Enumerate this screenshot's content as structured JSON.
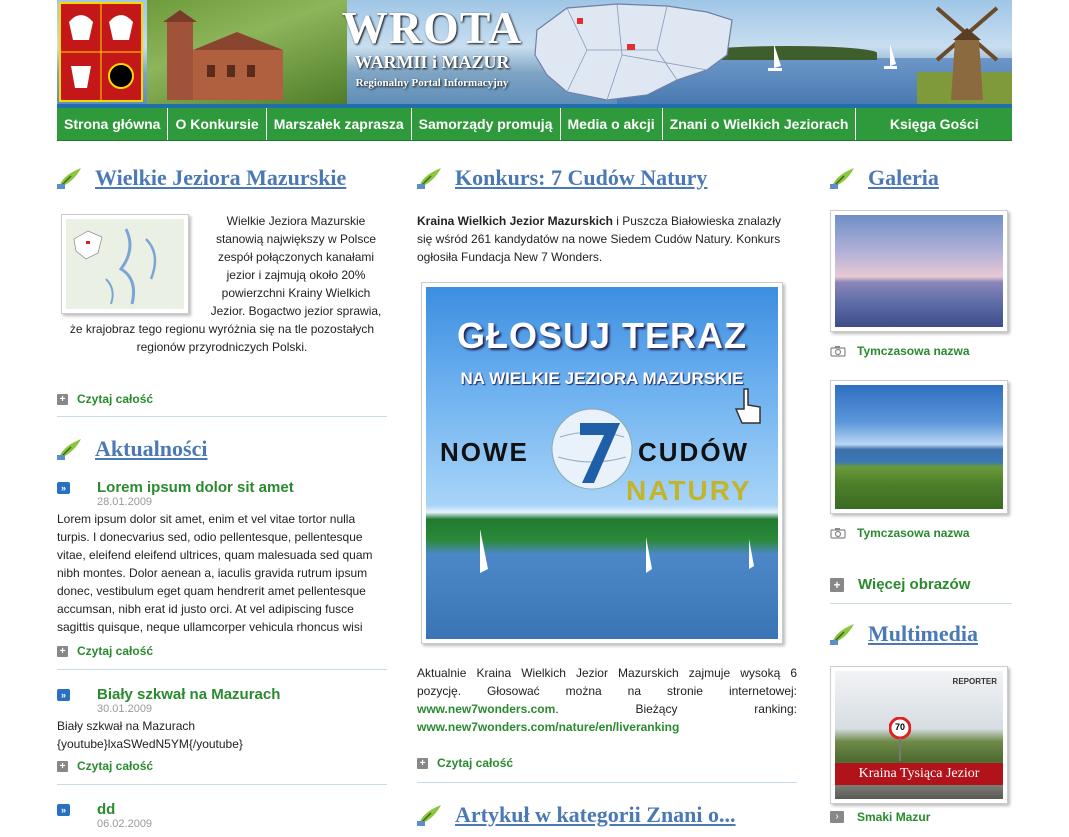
{
  "brand": {
    "title": "WROTA",
    "subtitle": "WARMII i MAZUR",
    "tagline": "Regionalny Portal Informacyjny"
  },
  "nav": [
    "Strona główna",
    "O Konkursie",
    "Marszałek zaprasza",
    "Samorządy promują",
    "Media o akcji",
    "Znani o Wielkich Jeziorach",
    "Księga Gości"
  ],
  "left": {
    "title": "Wielkie Jeziora Mazurskie",
    "text": "Wielkie Jeziora Mazurskie stanowią największy w Polsce zespół połączonych kanałami jezior i zajmują około 20% powierzchni Krainy Wielkich Jezior. Bogactwo jezior sprawia, że krajobraz tego regionu wyróżnia się na tle pozostałych regionów przyrodniczych Polski.",
    "more": "Czytaj całość",
    "news_title": "Aktualności",
    "news": [
      {
        "title": "Lorem ipsum dolor sit amet",
        "date": "28.01.2009",
        "text": "Lorem ipsum dolor sit amet, enim et vel vitae tortor nulla turpis.  I donecvarius sed, odio pellentesque, pellentesque vitae, eleifend eleifend ultrices, quam malesuada sed quam nibh montes. Dolor aenean a, iaculis gravida rutrum ipsum donec, vestibulum eget quam hendrerit amet pellentesque accumsan, nibh erat id justo orci. At vel adipiscing fusce sagittis quisque, neque ullamcorper vehicula rhoncus wisi",
        "more": "Czytaj całość"
      },
      {
        "title": "Biały szkwał na Mazurach",
        "date": "30.01.2009",
        "text": "Biały szkwał na Mazurach {youtube}lxaSWedN5YM{/youtube}",
        "more": "Czytaj całość"
      },
      {
        "title": "dd",
        "date": "06.02.2009"
      }
    ]
  },
  "center": {
    "title": "Konkurs: 7 Cudów Natury",
    "intro_bold": "Kraina Wielkich Jezior Mazurskich",
    "intro_rest": " i Puszcza Białowieska znalazły się wśród 261 kandydatów na nowe Siedem Cudów Natury. Konkurs ogłosiła Fundacja New 7 Wonders.",
    "ad": {
      "line1": "GŁOSUJ TERAZ",
      "line2": "NA WIELKIE JEZIORA MAZURSKIE",
      "line3a": "NOWE",
      "line3b": "CUDÓW",
      "line4": "NATURY"
    },
    "para": "Aktualnie Kraina Wielkich Jezior Mazurskich zajmuje wysoką 6 pozycję. Głosować można na stronie internetowej: ",
    "link1": "www.new7wonders.com",
    "mid": ". Bieżący ranking: ",
    "link2": "www.new7wonders.com/nature/en/liveranking",
    "more": "Czytaj całość",
    "title2": "Artykuł w kategorii Znani o..."
  },
  "right": {
    "gallery_title": "Galeria",
    "gallery": [
      {
        "caption": "Tymczasowa nazwa"
      },
      {
        "caption": "Tymczasowa nazwa"
      }
    ],
    "more_images": "Więcej obrazów",
    "multimedia_title": "Multimedia",
    "video_caption": "Kraina Tysiąca Jezior",
    "video_badge": "REPORTER",
    "sign": "70",
    "video_link": "Smaki Mazur"
  },
  "colors": {
    "nav_green": "#2f9a3c",
    "heading_blue": "#4a79b5",
    "link_green": "#2a8a2f"
  }
}
